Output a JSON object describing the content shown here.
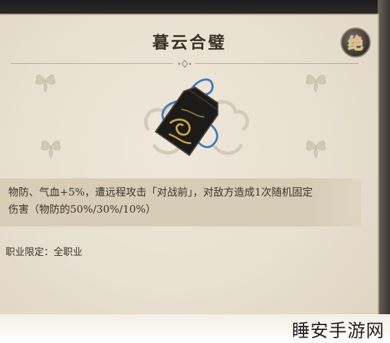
{
  "item": {
    "name": "暮云合璧",
    "badge": "绝",
    "description_line1": "物防、气血+5%，遭远程攻击「对战前」，对敌方造成1次随机固定",
    "description_line2": "伤害（物防的50%/30%/10%）",
    "restriction": "职业限定：全职业"
  },
  "watermark": "睡安手游网",
  "colors": {
    "panel": "#e7dfcf",
    "text": "#3b332b",
    "title": "#3a3026",
    "desc_box": "#d8cdb7",
    "token_body": "#1c1b1a",
    "token_gold": "#c8a24a",
    "cord": "#3f78b8"
  },
  "icons": [
    "flower-ornament-icon",
    "cloud-pattern-icon",
    "token-amulet-icon",
    "rarity-badge-icon"
  ]
}
